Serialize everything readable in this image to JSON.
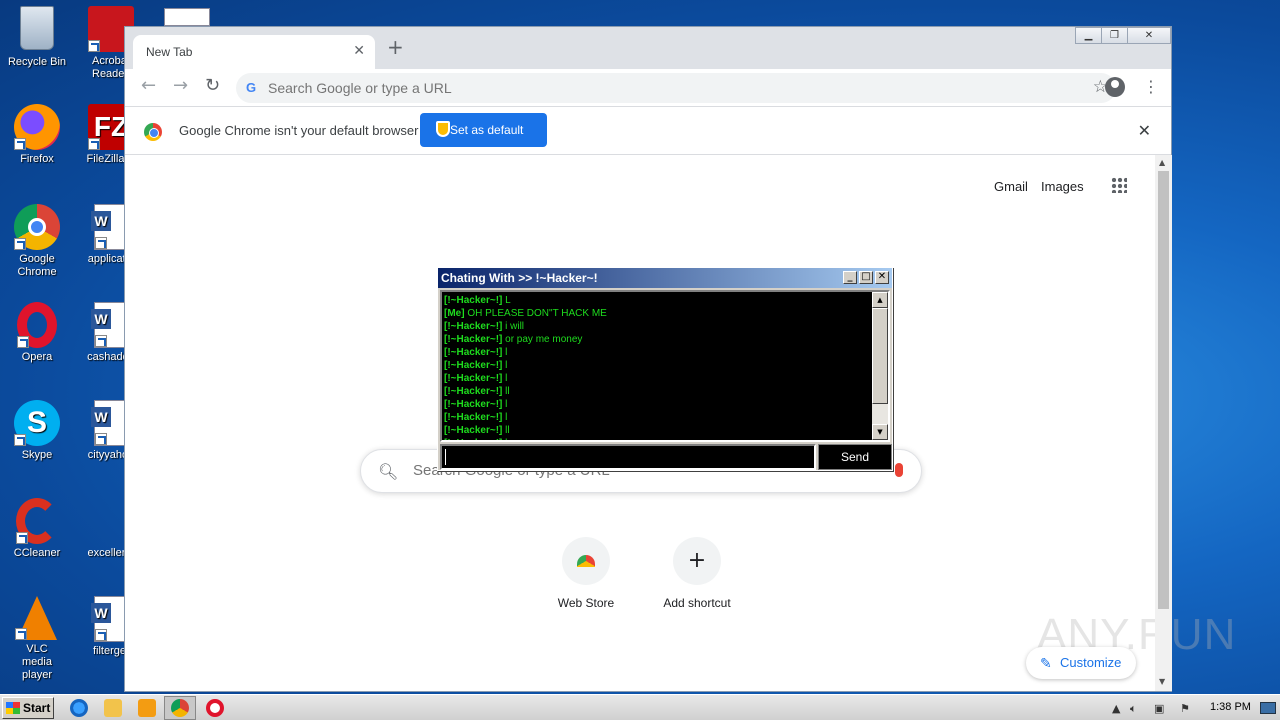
{
  "desktop": {
    "icons": [
      {
        "label": "Recycle Bin"
      },
      {
        "label": "Acrobat Reader"
      },
      {
        "label": "Firefox"
      },
      {
        "label": "FileZilla C"
      },
      {
        "label": "Google Chrome"
      },
      {
        "label": "applicatio"
      },
      {
        "label": "Opera"
      },
      {
        "label": "cashadde"
      },
      {
        "label": "Skype"
      },
      {
        "label": "cityyahoo"
      },
      {
        "label": "CCleaner"
      },
      {
        "label": "excellentr"
      },
      {
        "label": "VLC media player"
      },
      {
        "label": "filterget"
      }
    ]
  },
  "browser": {
    "tab_title": "New Tab",
    "tab_close": "✕",
    "new_tab": "+",
    "omnibox_placeholder": "Search Google or type a URL",
    "infobar": {
      "message": "Google Chrome isn't your default browser",
      "button": "Set as default",
      "close": "✕"
    },
    "toplinks": {
      "gmail": "Gmail",
      "images": "Images"
    },
    "search_placeholder": "Search Google or type a URL",
    "shortcuts": [
      {
        "label": "Web Store"
      },
      {
        "label": "Add shortcut",
        "glyph": "+"
      }
    ],
    "customize": "Customize",
    "watermark": "ANY.RUN"
  },
  "chat_window": {
    "title": "Chating With >> !~Hacker~!",
    "buttons": {
      "minimize": "_",
      "maximize": "□",
      "close": "✕"
    },
    "messages": [
      {
        "who": "[!~Hacker~!]",
        "text": "L"
      },
      {
        "who": "[Me]",
        "text": "OH PLEASE DON\"T HACK ME"
      },
      {
        "who": "[!~Hacker~!]",
        "text": "i will"
      },
      {
        "who": "[!~Hacker~!]",
        "text": "or pay me money"
      },
      {
        "who": "[!~Hacker~!]",
        "text": "l"
      },
      {
        "who": "[!~Hacker~!]",
        "text": "l"
      },
      {
        "who": "[!~Hacker~!]",
        "text": "l"
      },
      {
        "who": "[!~Hacker~!]",
        "text": "ll"
      },
      {
        "who": "[!~Hacker~!]",
        "text": "l"
      },
      {
        "who": "[!~Hacker~!]",
        "text": "l"
      },
      {
        "who": "[!~Hacker~!]",
        "text": "ll"
      },
      {
        "who": "[!~Hacker~!]",
        "text": "l"
      }
    ],
    "input_value": "",
    "send": "Send"
  },
  "taskbar": {
    "start": "Start",
    "clock": "1:38 PM"
  },
  "colors": {
    "chat_text": "#1edc1e",
    "infobar_button": "#1a73e8",
    "desktop_bg": "#1466c2"
  }
}
